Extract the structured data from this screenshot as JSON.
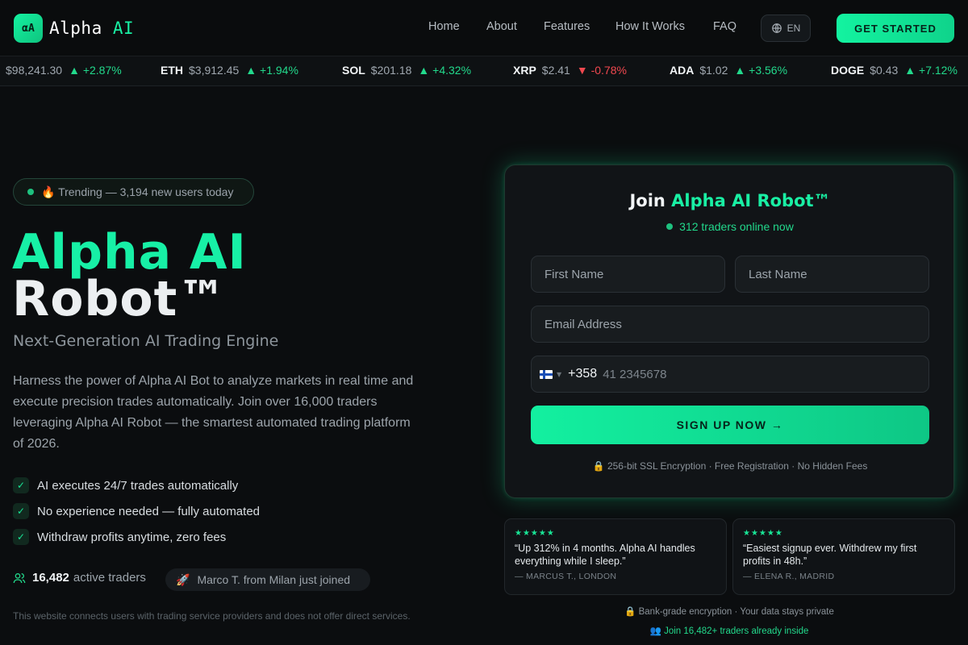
{
  "brand": {
    "mark": "αA",
    "name": "Alpha",
    "name_accent": "AI"
  },
  "nav": {
    "items": [
      {
        "label": "Home"
      },
      {
        "label": "About"
      },
      {
        "label": "Features"
      },
      {
        "label": "How It Works"
      },
      {
        "label": "FAQ"
      }
    ],
    "language": "EN",
    "cta_label": "GET STARTED"
  },
  "ticker": [
    {
      "symbol": "",
      "price": "$98,241.30",
      "arrow": "▲",
      "change": "+2.87%",
      "direction": "up"
    },
    {
      "symbol": "ETH",
      "price": "$3,912.45",
      "arrow": "▲",
      "change": "+1.94%",
      "direction": "up"
    },
    {
      "symbol": "SOL",
      "price": "$201.18",
      "arrow": "▲",
      "change": "+4.32%",
      "direction": "up"
    },
    {
      "symbol": "XRP",
      "price": "$2.41",
      "arrow": "▼",
      "change": "-0.78%",
      "direction": "down"
    },
    {
      "symbol": "ADA",
      "price": "$1.02",
      "arrow": "▲",
      "change": "+3.56%",
      "direction": "up"
    },
    {
      "symbol": "DOGE",
      "price": "$0.43",
      "arrow": "▲",
      "change": "+7.12%",
      "direction": "up"
    }
  ],
  "hero": {
    "trending": "🔥 Trending — 3,194 new users today",
    "title_line1": "Alpha AI",
    "title_line2": "Robot™",
    "subtitle": "Next-Generation AI Trading Engine",
    "description": "Harness the power of Alpha AI Bot to analyze markets in real time and execute precision trades automatically. Join over 16,000 traders leveraging Alpha AI Robot — the smartest automated trading platform of 2026.",
    "checks": [
      "AI executes 24/7 trades automatically",
      "No experience needed — fully automated",
      "Withdraw profits anytime, zero fees"
    ],
    "traders_count": "16,482",
    "traders_label": "active traders",
    "joined_notice": "Marco T. from Milan just joined",
    "disclaimer": "This website connects users with trading service providers and does not offer direct services."
  },
  "form": {
    "title_prefix": "Join",
    "title_accent": "Alpha AI Robot™",
    "online": "312 traders online now",
    "first_name_placeholder": "First Name",
    "last_name_placeholder": "Last Name",
    "email_placeholder": "Email Address",
    "dial_code": "+358",
    "phone_placeholder": "41 2345678",
    "submit_label": "SIGN UP NOW →",
    "security_note": "🔒 256-bit SSL Encryption · Free Registration · No Hidden Fees"
  },
  "reviews": [
    {
      "stars": "★★★★★",
      "quote": "“Up 312% in 4 months. Alpha AI handles everything while I sleep.”",
      "author": "— MARCUS T., LONDON"
    },
    {
      "stars": "★★★★★",
      "quote": "“Easiest signup ever. Withdrew my first profits in 48h.”",
      "author": "— ELENA R., MADRID"
    }
  ],
  "footer": {
    "bank_note": "🔒 Bank-grade encryption · Your data stays private",
    "join_note": "👥 Join 16,482+ traders already inside"
  },
  "colors": {
    "accent": "#19f0a4",
    "background": "#0b0d0f",
    "up": "#22d98c",
    "down": "#f0484f"
  }
}
